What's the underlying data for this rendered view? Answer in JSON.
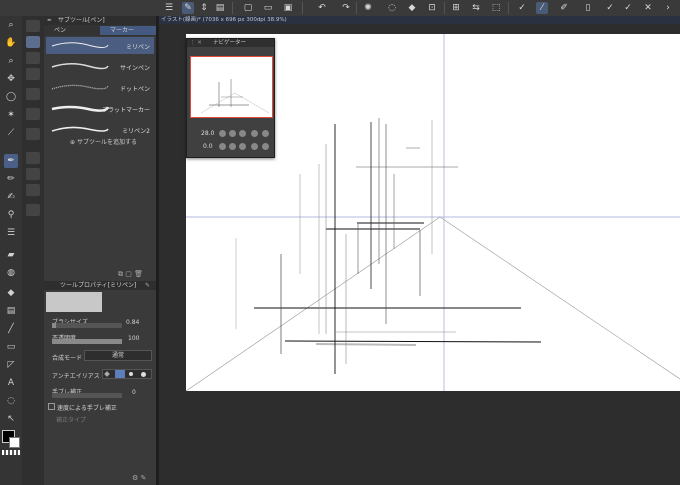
{
  "document_tab": "イラスト(線画)* (7036 x 696 px 300dpi 38.9%)",
  "subtool_panel": {
    "header": "サブツール[ペン]",
    "tabs": [
      "ペン",
      "マーカー"
    ],
    "brushes": [
      "ミリペン",
      "サインペン",
      "ドットペン",
      "フラットマーカー",
      "ミリペン2"
    ],
    "add_label": "サブツールを追加する"
  },
  "tool_property": {
    "header": "ツールプロパティ[ミリペン]",
    "brush_size_label": "ブラシサイズ",
    "brush_size_value": "0.84",
    "opacity_label": "不透明度",
    "opacity_value": "100",
    "opacity_level": 1.0,
    "blend_mode_label": "合成モード",
    "blend_mode_value": "通常",
    "antialias_label": "アンチエイリアス",
    "stabilization_label": "手ブレ補正",
    "stabilization_value": "0",
    "speed_stabilization_label": "速度による手ブレ補正",
    "taper_label": "補正タイプ"
  },
  "navigator": {
    "title": "ナビゲーター",
    "zoom": "28.0",
    "rotation": "0.0"
  }
}
